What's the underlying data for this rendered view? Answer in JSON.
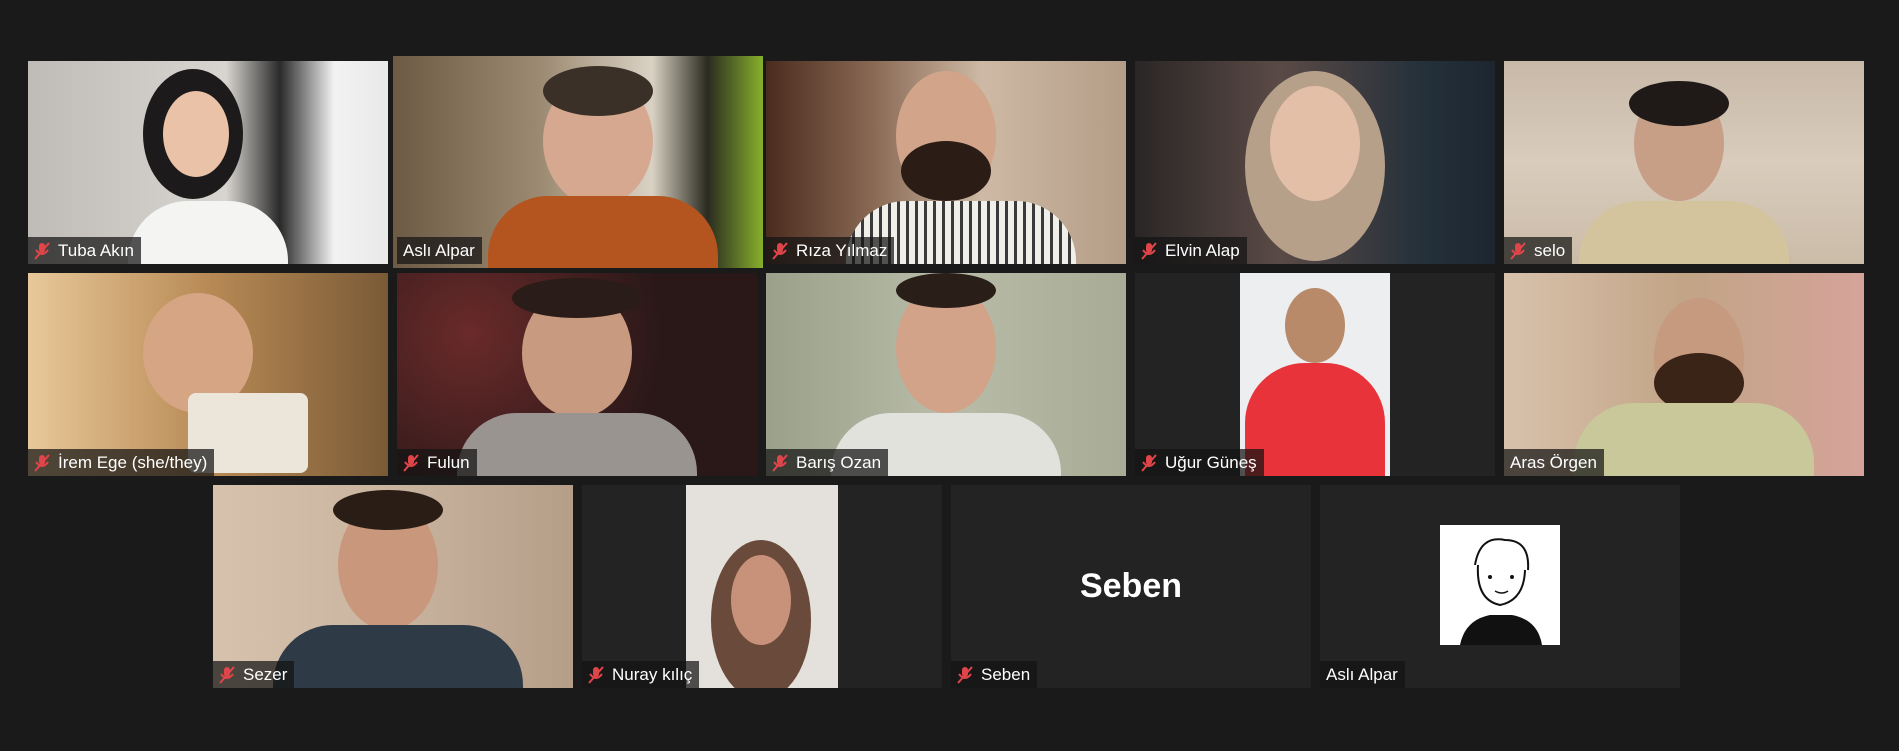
{
  "participants": [
    {
      "name": "Tuba Akın",
      "muted": true,
      "active": false
    },
    {
      "name": "Aslı Alpar",
      "muted": false,
      "active": true
    },
    {
      "name": "Rıza Yılmaz",
      "muted": true,
      "active": false
    },
    {
      "name": "Elvin Alap",
      "muted": true,
      "active": false
    },
    {
      "name": "selo",
      "muted": true,
      "active": false
    },
    {
      "name": "İrem Ege (she/they)",
      "muted": true,
      "active": false
    },
    {
      "name": "Fulun",
      "muted": true,
      "active": false
    },
    {
      "name": "Barış Ozan",
      "muted": true,
      "active": false
    },
    {
      "name": "Uğur Güneş",
      "muted": true,
      "active": false
    },
    {
      "name": "Aras Örgen",
      "muted": false,
      "active": false
    },
    {
      "name": "Sezer",
      "muted": true,
      "active": false
    },
    {
      "name": "Nuray kılıç",
      "muted": true,
      "active": false
    },
    {
      "name": "Seben",
      "muted": true,
      "active": false,
      "video_off": true,
      "display_text": "Seben"
    },
    {
      "name": "Aslı Alpar",
      "muted": false,
      "active": false,
      "video_off": true,
      "avatar": "sketch-portrait"
    }
  ],
  "colors": {
    "background": "#1a1a1a",
    "tile": "#232323",
    "active_speaker_border": "#e8f07a",
    "mute_icon": "#e0454a"
  },
  "icons": {
    "mute": "microphone-muted-icon"
  }
}
